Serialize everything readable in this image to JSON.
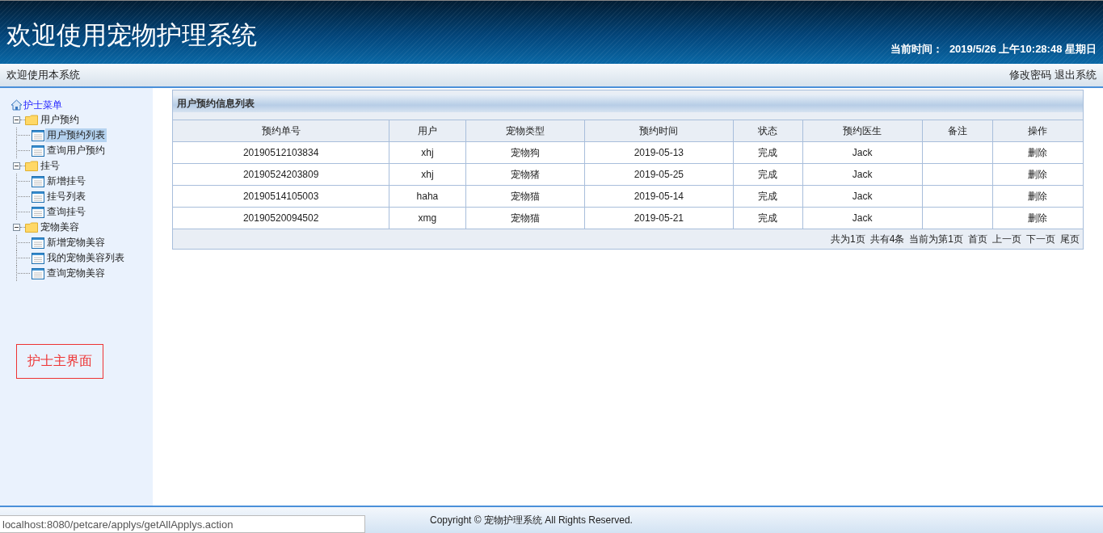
{
  "header": {
    "title": "欢迎使用宠物护理系统",
    "time_label": "当前时间：",
    "time_value": "2019/5/26 上午10:28:48 星期日"
  },
  "subbar": {
    "welcome": "欢迎使用本系统",
    "links": [
      "修改密码",
      "退出系统"
    ]
  },
  "sidebar": {
    "root": "护士菜单",
    "tree": [
      {
        "label": "用户预约",
        "expanded": true,
        "children": [
          {
            "label": "用户预约列表",
            "selected": true
          },
          {
            "label": "查询用户预约",
            "selected": false
          }
        ]
      },
      {
        "label": "挂号",
        "expanded": true,
        "children": [
          {
            "label": "新增挂号",
            "selected": false
          },
          {
            "label": "挂号列表",
            "selected": false
          },
          {
            "label": "查询挂号",
            "selected": false
          }
        ]
      },
      {
        "label": "宠物美容",
        "expanded": true,
        "children": [
          {
            "label": "新增宠物美容",
            "selected": false
          },
          {
            "label": "我的宠物美容列表",
            "selected": false
          },
          {
            "label": "查询宠物美容",
            "selected": false
          }
        ]
      }
    ],
    "note": "护士主界面"
  },
  "panel": {
    "title": "用户预约信息列表",
    "columns": [
      "预约单号",
      "用户",
      "宠物类型",
      "预约时间",
      "状态",
      "预约医生",
      "备注",
      "操作"
    ],
    "rows": [
      [
        "20190512103834",
        "xhj",
        "宠物狗",
        "2019-05-13",
        "完成",
        "Jack",
        "",
        "删除"
      ],
      [
        "20190524203809",
        "xhj",
        "宠物猪",
        "2019-05-25",
        "完成",
        "Jack",
        "",
        "删除"
      ],
      [
        "20190514105003",
        "haha",
        "宠物猫",
        "2019-05-14",
        "完成",
        "Jack",
        "",
        "删除"
      ],
      [
        "20190520094502",
        "xmg",
        "宠物猫",
        "2019-05-21",
        "完成",
        "Jack",
        "",
        "删除"
      ]
    ],
    "pager_info": [
      "共为1页",
      "共有4条",
      "当前为第1页"
    ],
    "pager_links": [
      "首页",
      "上一页",
      "下一页",
      "尾页"
    ]
  },
  "footer": {
    "copyright": "Copyright © 宠物护理系统 All Rights Reserved.",
    "status_url": "localhost:8080/petcare/applys/getAllApplys.action"
  }
}
